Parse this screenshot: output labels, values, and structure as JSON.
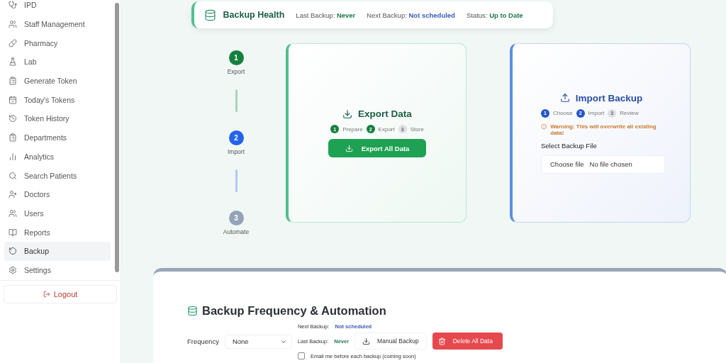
{
  "sidebar": {
    "items": [
      {
        "label": "IPD",
        "selected": false
      },
      {
        "label": "Staff Management",
        "selected": false
      },
      {
        "label": "Pharmacy",
        "selected": false
      },
      {
        "label": "Lab",
        "selected": false
      },
      {
        "label": "Generate Token",
        "selected": false
      },
      {
        "label": "Today's Tokens",
        "selected": false
      },
      {
        "label": "Token History",
        "selected": false
      },
      {
        "label": "Departments",
        "selected": false
      },
      {
        "label": "Analytics",
        "selected": false
      },
      {
        "label": "Search Patients",
        "selected": false
      },
      {
        "label": "Doctors",
        "selected": false
      },
      {
        "label": "Users",
        "selected": false
      },
      {
        "label": "Reports",
        "selected": false
      },
      {
        "label": "Backup",
        "selected": true
      },
      {
        "label": "Settings",
        "selected": false
      }
    ],
    "logout": "Logout"
  },
  "health": {
    "title": "Backup Health",
    "stats": [
      {
        "label": "Last Backup:",
        "value": "Never",
        "color": "#1f7a4d"
      },
      {
        "label": "Next Backup:",
        "value": "Not scheduled",
        "color": "#3b5bb5"
      },
      {
        "label": "Status:",
        "value": "Up to Date",
        "color": "#1f7a4d"
      }
    ]
  },
  "stepper": [
    {
      "number": "1",
      "label": "Export",
      "color": "#15803d"
    },
    {
      "number": "2",
      "label": "Import",
      "color": "#2563eb"
    },
    {
      "number": "3",
      "label": "Automate",
      "color": "#94a3b8"
    }
  ],
  "export_card": {
    "title": "Export Data",
    "steps": [
      {
        "number": "1",
        "label": "Prepare",
        "active": true
      },
      {
        "number": "2",
        "label": "Export",
        "active": true
      },
      {
        "number": "3",
        "label": "Store",
        "active": false
      }
    ],
    "button": "Export All Data"
  },
  "import_card": {
    "title": "Import Backup",
    "steps": [
      {
        "number": "1",
        "label": "Choose",
        "active": true
      },
      {
        "number": "2",
        "label": "Import",
        "active": true
      },
      {
        "number": "3",
        "label": "Review",
        "active": false
      }
    ],
    "warning": "Warning: This will overwrite all existing data!",
    "file_label": "Select Backup File",
    "file_button": "Choose file",
    "file_status": "No file chosen"
  },
  "automation": {
    "title": "Backup Frequency & Automation",
    "frequency_label": "Frequency",
    "frequency_value": "None",
    "next_label": "Next Backup:",
    "next_value": "Not scheduled",
    "last_label": "Last Backup:",
    "last_value": "Never",
    "manual_button": "Manual Backup",
    "delete_button": "Delete All Data",
    "email_option": {
      "label": "Email me before each backup (coming soon)",
      "checked": false
    }
  }
}
